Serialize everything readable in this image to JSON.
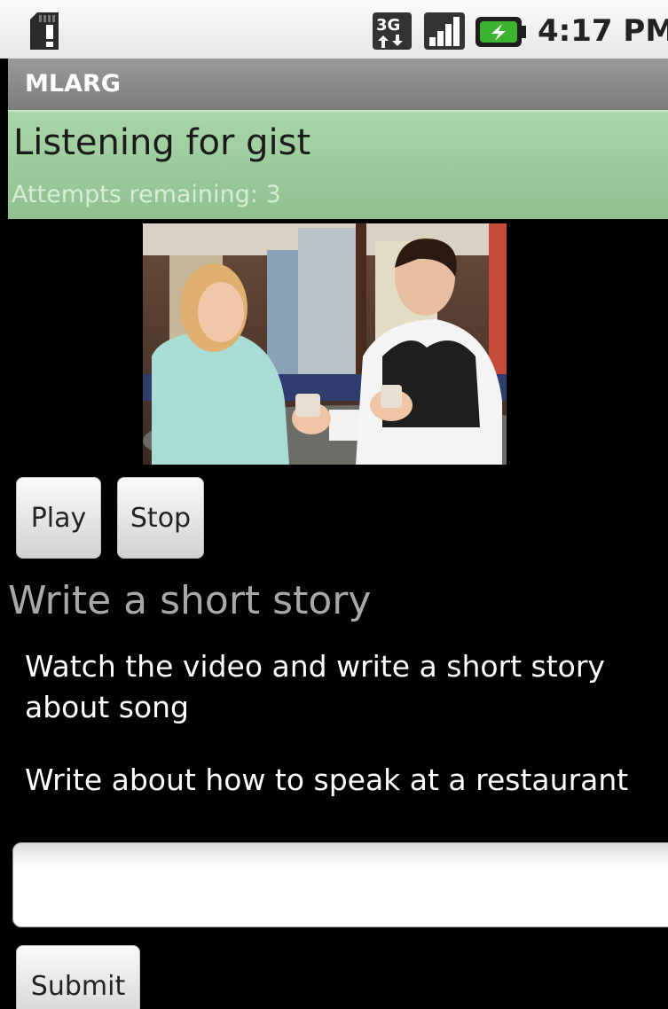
{
  "status_bar": {
    "time": "4:17 PM",
    "icons": [
      "sd-card-warning-icon",
      "3g-data-icon",
      "signal-strength-icon",
      "battery-charging-icon"
    ]
  },
  "app": {
    "title": "MLARG"
  },
  "header": {
    "activity_title": "Listening for gist",
    "attempts": "Attempts remaining: 3"
  },
  "media": {
    "thumbnail": "video-thumbnail-two-people-talking",
    "play_label": "Play",
    "stop_label": "Stop"
  },
  "task": {
    "section_title": "Write a short story",
    "instruction_1": "Watch the video and write a short story about song",
    "instruction_2": "Write about how to speak at a restaurant"
  },
  "form": {
    "answer_value": "",
    "answer_placeholder": "",
    "submit_label": "Submit"
  },
  "colors": {
    "header_bg": "#a3d1a3",
    "title_bar_bg": "#8a8a8a",
    "background": "#000000",
    "battery_green": "#3cb431"
  }
}
